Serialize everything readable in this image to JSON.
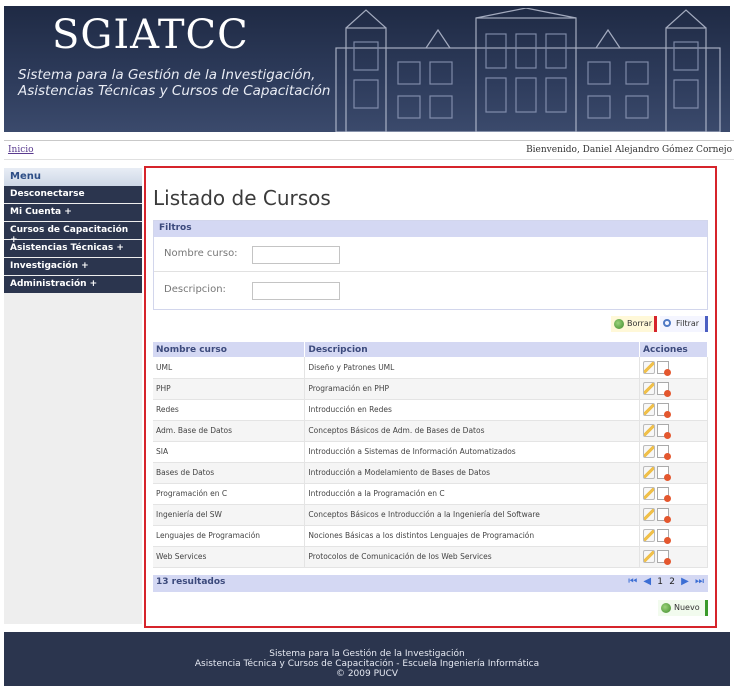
{
  "header": {
    "logo": "SGIATCC",
    "subtitle_line1": "Sistema para la Gestión de la Investigación,",
    "subtitle_line2": "Asistencias Técnicas y Cursos de Capacitación"
  },
  "topbar": {
    "home_link": "Inicio",
    "welcome": "Bienvenido, Daniel Alejandro Gómez Cornejo"
  },
  "sidebar": {
    "title": "Menu",
    "items": [
      {
        "label": "Desconectarse"
      },
      {
        "label": "Mi Cuenta +"
      },
      {
        "label": "Cursos de Capacitación +"
      },
      {
        "label": "Asistencias Técnicas +"
      },
      {
        "label": "Investigación +"
      },
      {
        "label": "Administración +"
      }
    ]
  },
  "main": {
    "title": "Listado de Cursos",
    "filters": {
      "header": "Filtros",
      "nombre_label": "Nombre curso:",
      "nombre_value": "",
      "descripcion_label": "Descripcion:",
      "descripcion_value": ""
    },
    "buttons": {
      "borrar": "Borrar",
      "filtrar": "Filtrar",
      "nuevo": "Nuevo"
    },
    "table": {
      "headers": [
        "Nombre curso",
        "Descripcion",
        "Acciones"
      ],
      "rows": [
        [
          "UML",
          "Diseño y Patrones UML"
        ],
        [
          "PHP",
          "Programación en PHP"
        ],
        [
          "Redes",
          "Introducción en Redes"
        ],
        [
          "Adm. Base de Datos",
          "Conceptos Básicos de Adm. de Bases de Datos"
        ],
        [
          "SIA",
          "Introducción a Sistemas de Información Automatizados"
        ],
        [
          "Bases de Datos",
          "Introducción a Modelamiento de Bases de Datos"
        ],
        [
          "Programación en C",
          "Introducción a la Programación en C"
        ],
        [
          "Ingeniería del SW",
          "Conceptos Básicos e Introducción a la Ingeniería del Software"
        ],
        [
          "Lenguajes de Programación",
          "Nociones Básicas a los distintos Lenguajes de Programación"
        ],
        [
          "Web Services",
          "Protocolos de Comunicación de los Web Services"
        ]
      ]
    },
    "results": "13 resultados",
    "pager": {
      "first": "⏮",
      "prev": "◀",
      "page1": "1",
      "page2": "2",
      "next": "▶",
      "last": "⏭"
    }
  },
  "footer": {
    "line1": "Sistema para la Gestión de la Investigación",
    "line2": "Asistencia Técnica y Cursos de Capacitación - Escuela Ingeniería Informática",
    "line3": "© 2009 PUCV"
  },
  "colors": {
    "accent_red": "#d6242b",
    "header_navy": "#2b354e",
    "table_header": "#d4d8f3"
  }
}
